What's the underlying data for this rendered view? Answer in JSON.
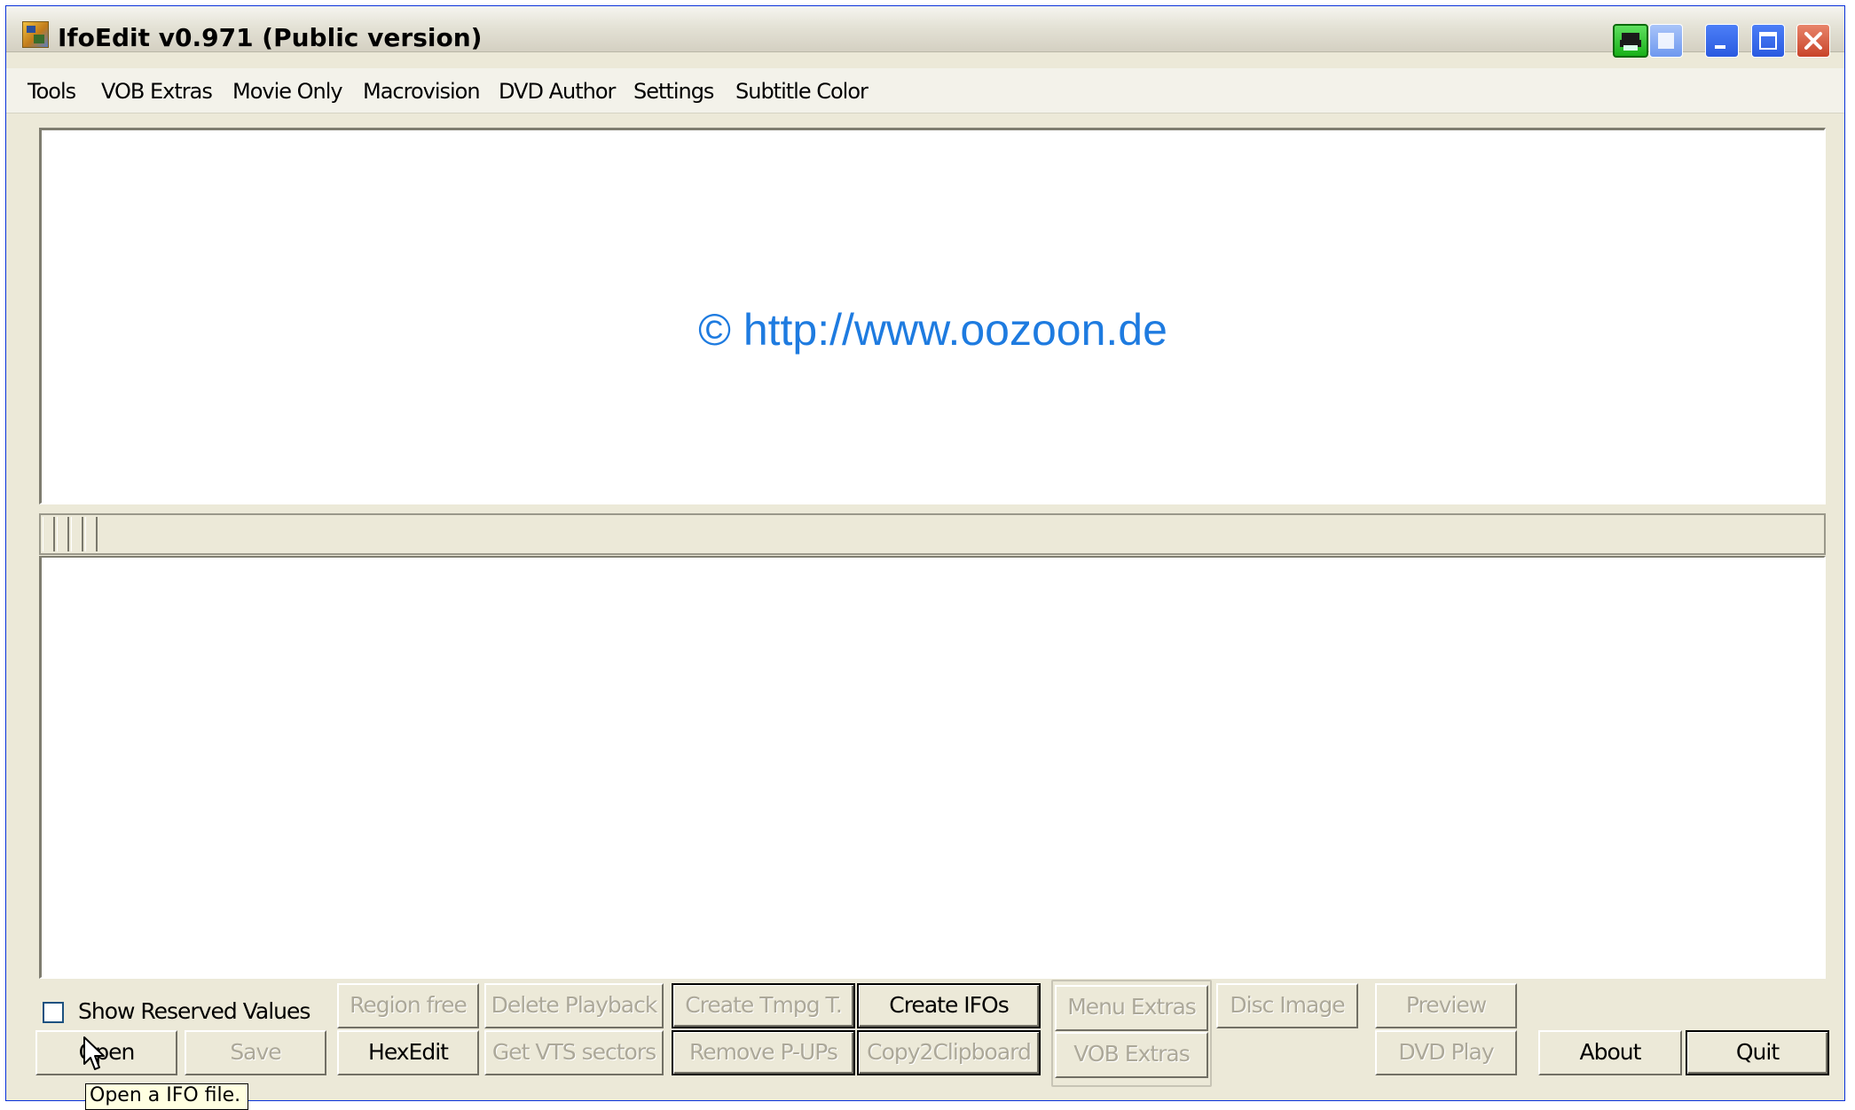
{
  "window": {
    "title": "IfoEdit v0.971 (Public version)",
    "controls": [
      "tray-icon",
      "rollup",
      "minimize",
      "maximize",
      "close"
    ]
  },
  "menu": [
    "Tools",
    "VOB Extras",
    "Movie Only",
    "Macrovision",
    "DVD Author",
    "Settings",
    "Subtitle Color"
  ],
  "top_panel": {
    "url_text": "© http://www.oozoon.de",
    "url_color": "#1e7be0"
  },
  "options": {
    "show_reserved_label": "Show Reserved Values",
    "show_reserved_checked": false
  },
  "buttons": {
    "open": "Open",
    "save": "Save",
    "region_free": "Region free",
    "hexedit": "HexEdit",
    "delete_playback": "Delete Playback",
    "get_vts_sectors": "Get VTS sectors",
    "create_tmpg": "Create Tmpg T.",
    "remove_pups": "Remove P-UPs",
    "create_ifos": "Create IFOs",
    "copy2clipboard": "Copy2Clipboard",
    "menu_extras": "Menu Extras",
    "vob_extras": "VOB Extras",
    "disc_image": "Disc Image",
    "preview": "Preview",
    "dvd_play": "DVD Play",
    "about": "About",
    "quit": "Quit"
  },
  "tooltip": "Open a IFO file."
}
